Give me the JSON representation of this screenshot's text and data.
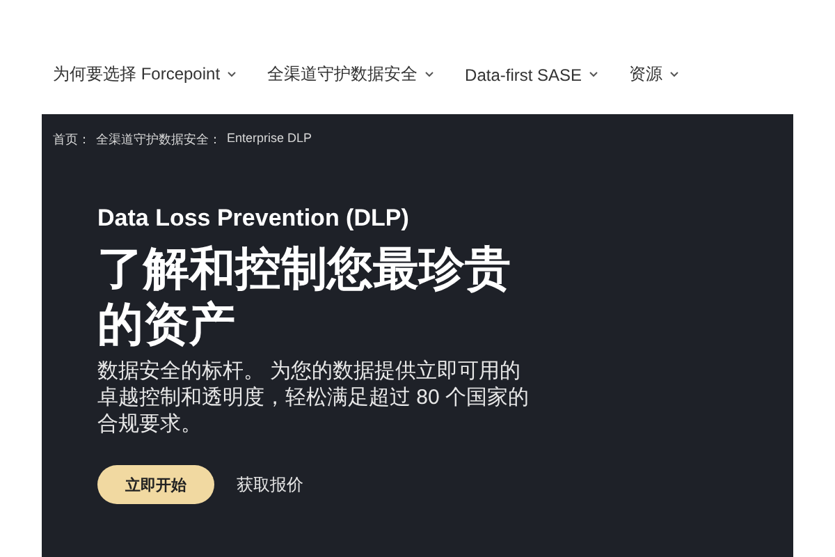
{
  "nav": {
    "items": [
      {
        "label": "为何要选择 Forcepoint"
      },
      {
        "label": "全渠道守护数据安全"
      },
      {
        "label": "Data-first SASE"
      },
      {
        "label": "资源"
      }
    ]
  },
  "hero": {
    "breadcrumb": [
      "首页：",
      "全渠道守护数据安全：",
      "Enterprise DLP"
    ],
    "eyebrow": "Data Loss Prevention (DLP)",
    "headline": "了解和控制您最珍贵的资产",
    "body": "数据安全的标杆。 为您的数据提供立即可用的卓越控制和透明度，轻松满足超过 80 个国家的合规要求。",
    "primary_button": "立即开始",
    "secondary_link": "获取报价"
  }
}
